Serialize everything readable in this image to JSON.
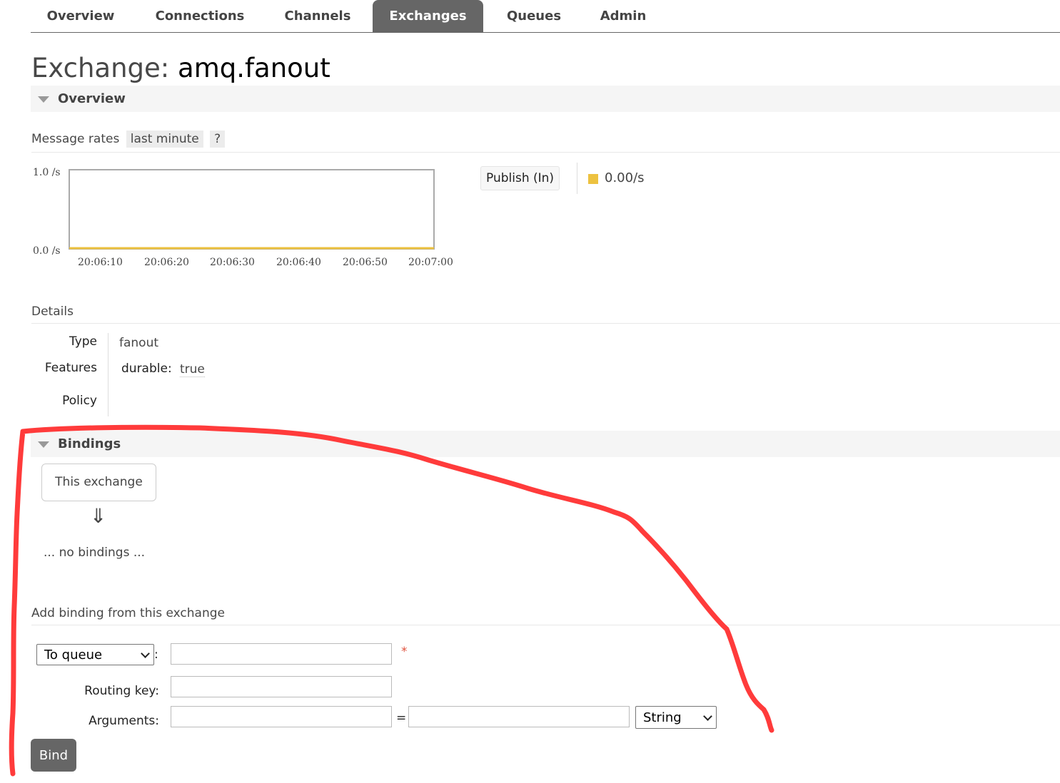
{
  "nav": {
    "tabs": [
      {
        "label": "Overview",
        "active": false
      },
      {
        "label": "Connections",
        "active": false
      },
      {
        "label": "Channels",
        "active": false
      },
      {
        "label": "Exchanges",
        "active": true
      },
      {
        "label": "Queues",
        "active": false
      },
      {
        "label": "Admin",
        "active": false
      }
    ]
  },
  "page": {
    "title_prefix": "Exchange:",
    "title_name": "amq.fanout"
  },
  "overview": {
    "section_label": "Overview",
    "message_rates_label": "Message rates",
    "range_option": "last minute",
    "help_label": "?"
  },
  "chart_data": {
    "type": "line",
    "x": [
      "20:06:10",
      "20:06:20",
      "20:06:30",
      "20:06:40",
      "20:06:50",
      "20:07:00"
    ],
    "series": [
      {
        "name": "Publish (In)",
        "values": [
          0,
          0,
          0,
          0,
          0,
          0
        ],
        "color": "#edc240"
      }
    ],
    "ylim": [
      0,
      1.0
    ],
    "y_ticks": [
      "1.0 /s",
      "0.0 /s"
    ],
    "legend": {
      "label": "Publish (In)",
      "rate": "0.00/s"
    }
  },
  "details": {
    "heading": "Details",
    "type_label": "Type",
    "type_value": "fanout",
    "features_label": "Features",
    "durable_key": "durable:",
    "durable_value": "true",
    "policy_label": "Policy"
  },
  "bindings": {
    "section_label": "Bindings",
    "this_exchange": "This exchange",
    "arrow": "⇓",
    "empty_text": "... no bindings ..."
  },
  "add_binding": {
    "heading": "Add binding from this exchange",
    "destination_type": "To queue",
    "colon": ":",
    "required_mark": "*",
    "routing_key_label": "Routing key:",
    "arguments_label": "Arguments:",
    "equals": "=",
    "argument_type": "String",
    "bind_label": "Bind"
  },
  "colors": {
    "active_tab": "#666666",
    "series": "#edc240",
    "annotation": "#ff3b3b"
  }
}
